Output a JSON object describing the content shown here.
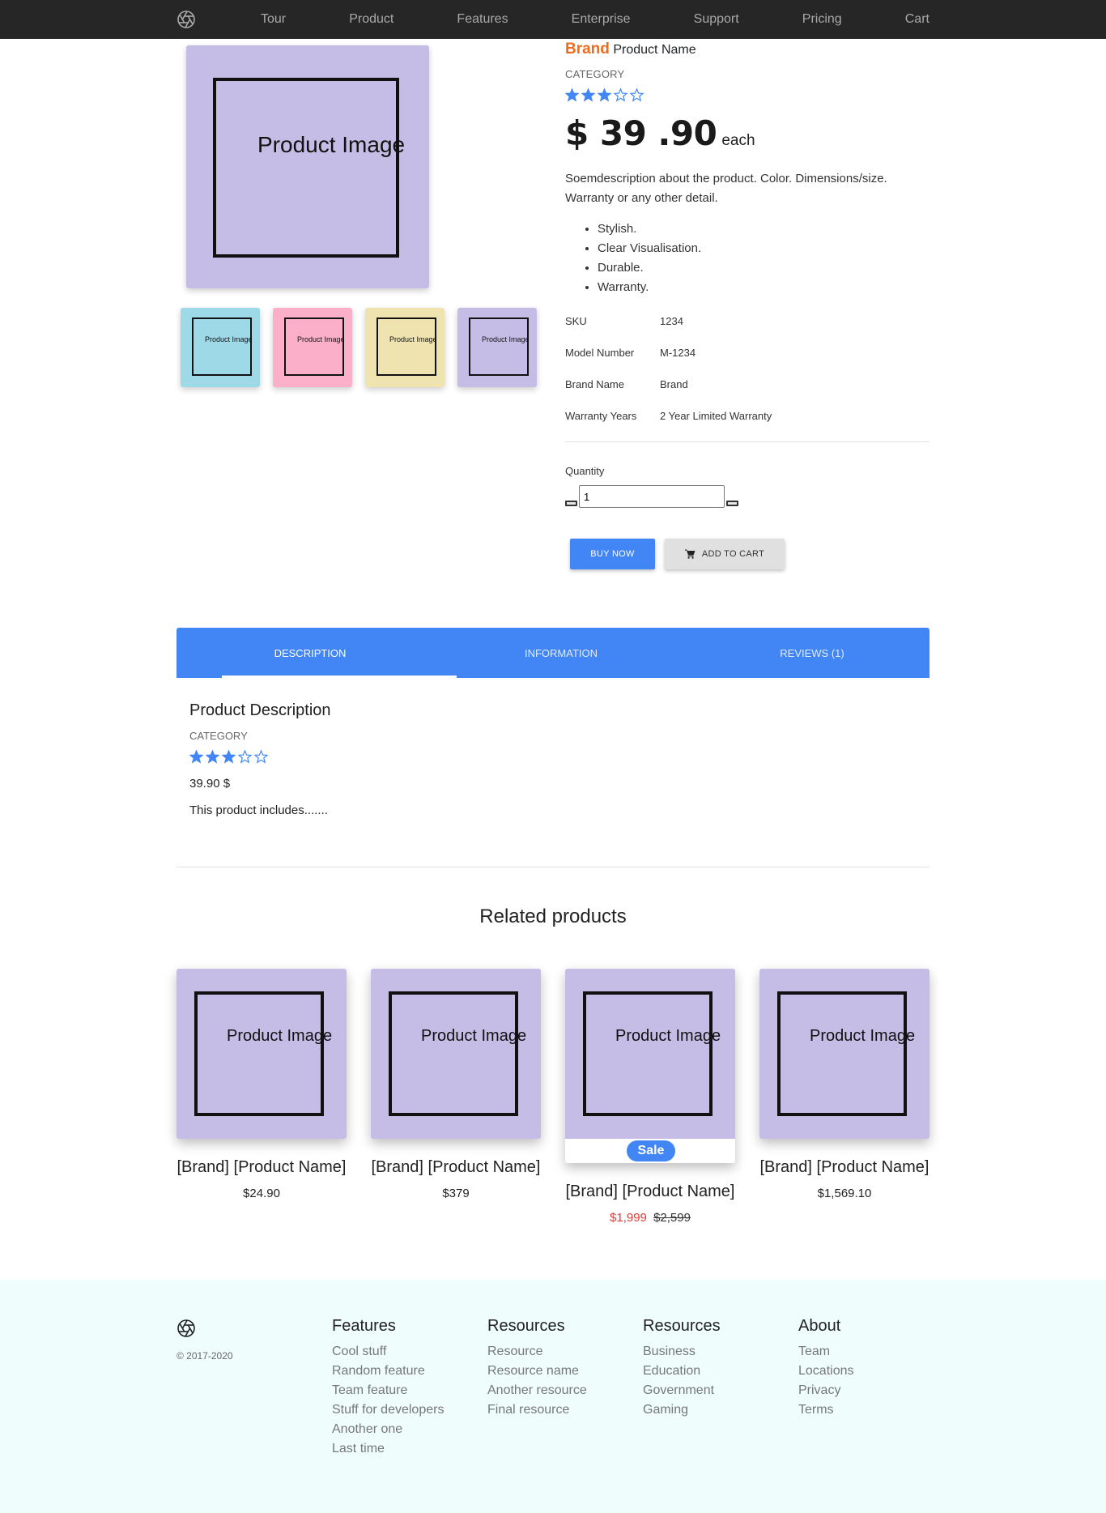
{
  "nav": {
    "logo_icon": "aperture-icon",
    "links": [
      "Tour",
      "Product",
      "Features",
      "Enterprise",
      "Support",
      "Pricing",
      "Cart"
    ]
  },
  "gallery": {
    "main_label": "Product Image",
    "main_color": "#c5bde6",
    "thumbs": [
      {
        "label": "Product Image",
        "color": "#9ed9e8"
      },
      {
        "label": "Product Image",
        "color": "#fbafc9"
      },
      {
        "label": "Product Image",
        "color": "#efe3b0"
      },
      {
        "label": "Product Image",
        "color": "#c5bde6"
      }
    ]
  },
  "product": {
    "brand": "Brand",
    "name": "Product Name",
    "category": "CATEGORY",
    "rating": 3,
    "rating_max": 5,
    "price": "$ 39 .90",
    "price_unit": "each",
    "description": "Soemdescription about the product. Color. Dimensions/size. Warranty or any other detail.",
    "features": [
      "Stylish.",
      "Clear Visualisation.",
      "Durable.",
      "Warranty."
    ],
    "specs": [
      {
        "key": "SKU",
        "value": "1234"
      },
      {
        "key": "Model Number",
        "value": "M-1234"
      },
      {
        "key": "Brand Name",
        "value": "Brand"
      },
      {
        "key": "Warranty Years",
        "value": "2 Year Limited Warranty"
      }
    ],
    "quantity_label": "Quantity",
    "quantity_value": "1",
    "buy_label": "BUY NOW",
    "cart_label": "ADD TO CART",
    "accent": "#4285f4",
    "brand_color": "#f26b1d"
  },
  "tabs": {
    "items": [
      "DESCRIPTION",
      "INFORMATION",
      "REVIEWS (1)"
    ],
    "active": "DESCRIPTION",
    "panel": {
      "title": "Product Description",
      "category": "CATEGORY",
      "rating": 3,
      "price": "39.90 $",
      "text": "This product includes......."
    }
  },
  "related": {
    "title": "Related products",
    "products": [
      {
        "name": "[Brand] [Product Name]",
        "price": "$24.90",
        "image_label": "Product Image"
      },
      {
        "name": "[Brand] [Product Name]",
        "price": "$379",
        "image_label": "Product Image"
      },
      {
        "name": "[Brand] [Product Name]",
        "sale_price": "$1,999",
        "old_price": "$2,599",
        "badge": "Sale",
        "image_label": "Product Image"
      },
      {
        "name": "[Brand] [Product Name]",
        "price": "$1,569.10",
        "image_label": "Product Image"
      }
    ]
  },
  "footer": {
    "copyright": "© 2017-2020",
    "columns": [
      {
        "title": "Features",
        "links": [
          "Cool stuff",
          "Random feature",
          "Team feature",
          "Stuff for developers",
          "Another one",
          "Last time"
        ]
      },
      {
        "title": "Resources",
        "links": [
          "Resource",
          "Resource name",
          "Another resource",
          "Final resource"
        ]
      },
      {
        "title": "Resources",
        "links": [
          "Business",
          "Education",
          "Government",
          "Gaming"
        ]
      },
      {
        "title": "About",
        "links": [
          "Team",
          "Locations",
          "Privacy",
          "Terms"
        ]
      }
    ]
  }
}
